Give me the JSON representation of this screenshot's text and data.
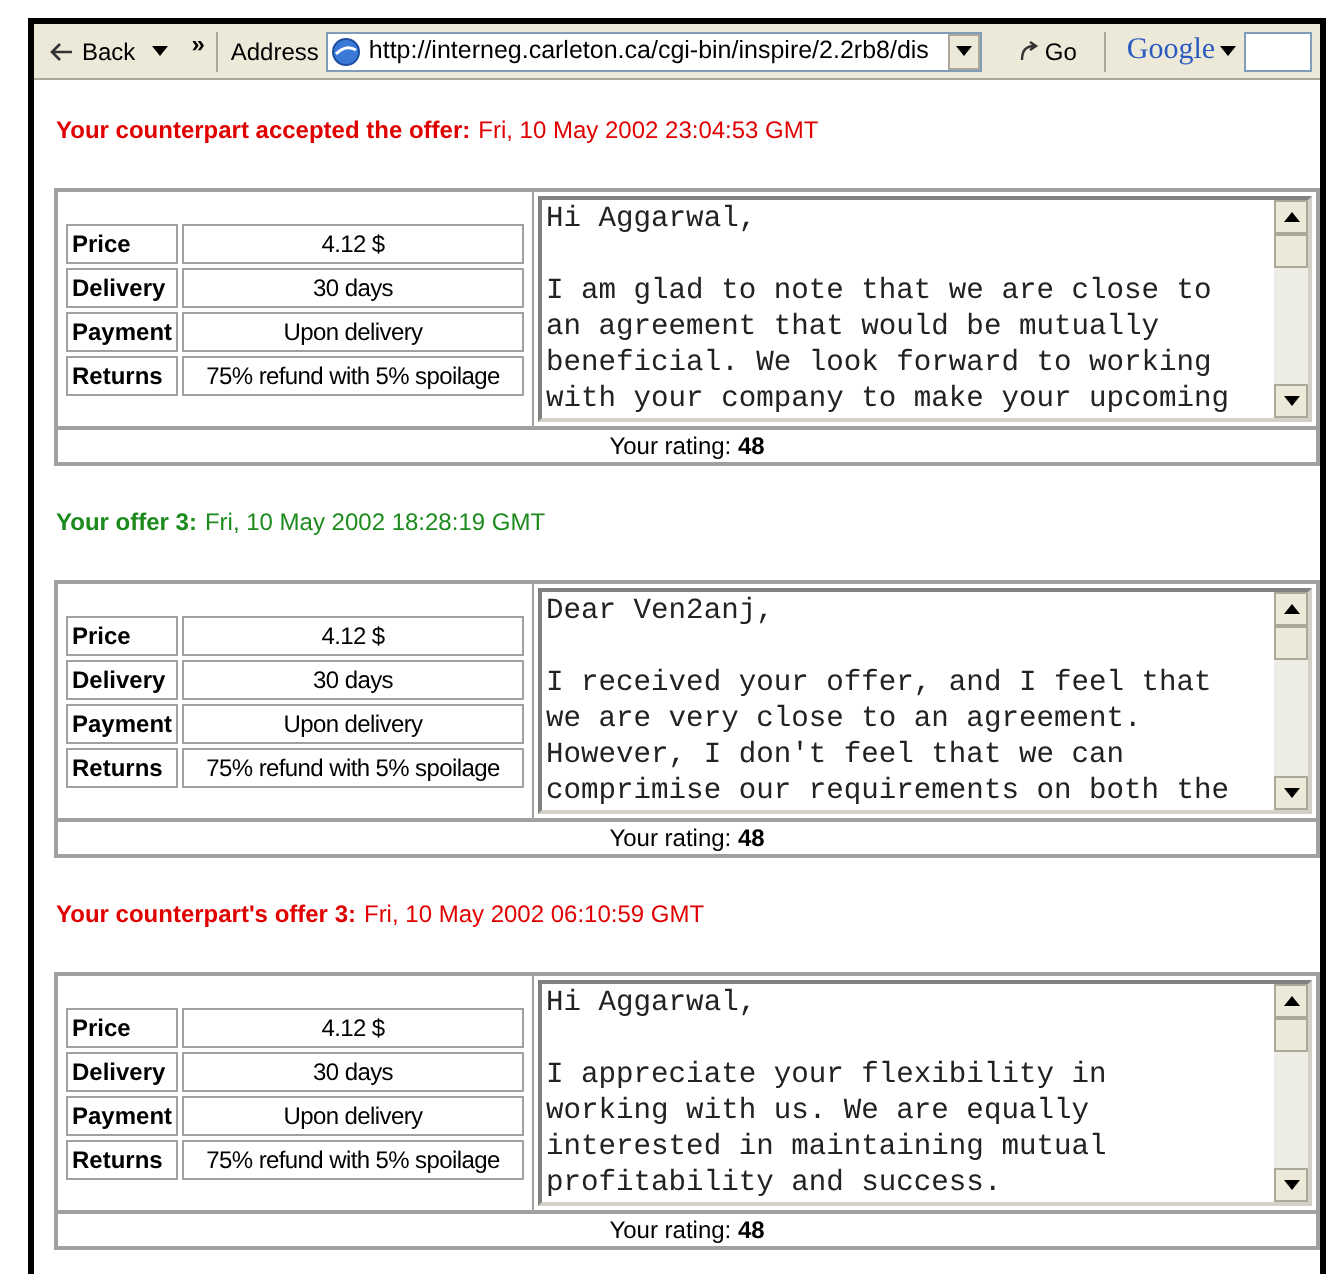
{
  "toolbar": {
    "back": "Back",
    "chevron": "»",
    "address_label": "Address",
    "url": "http://interneg.carleton.ca/cgi-bin/inspire/2.2rb8/dis",
    "go": "Go",
    "search_brand": "Google"
  },
  "offers": [
    {
      "kind": "counterpart",
      "label": "Your counterpart accepted the offer:",
      "date": "Fri, 10 May 2002 23:04:53 GMT",
      "terms": [
        {
          "name": "Price",
          "value": "4.12 $"
        },
        {
          "name": "Delivery",
          "value": "30 days"
        },
        {
          "name": "Payment",
          "value": "Upon delivery"
        },
        {
          "name": "Returns",
          "value": "75% refund with 5% spoilage"
        }
      ],
      "greeting": "Hi Aggarwal,",
      "message": [
        "I am glad to note that we are close to",
        "an agreement that would be mutually",
        "beneficial. We look forward to working",
        "with your company to make your upcoming"
      ],
      "rating_label": "Your rating:",
      "rating": "48"
    },
    {
      "kind": "own",
      "label": "Your offer 3:",
      "date": "Fri, 10 May 2002 18:28:19 GMT",
      "terms": [
        {
          "name": "Price",
          "value": "4.12 $"
        },
        {
          "name": "Delivery",
          "value": "30 days"
        },
        {
          "name": "Payment",
          "value": "Upon delivery"
        },
        {
          "name": "Returns",
          "value": "75% refund with 5% spoilage"
        }
      ],
      "greeting": "Dear Ven2anj,",
      "message": [
        "I received your offer, and I feel that",
        "we are very close to an agreement.",
        "However, I don't feel that we can",
        "comprimise our requirements on both the"
      ],
      "rating_label": "Your rating:",
      "rating": "48"
    },
    {
      "kind": "counterpart",
      "label": "Your counterpart's offer 3:",
      "date": "Fri, 10 May 2002 06:10:59 GMT",
      "terms": [
        {
          "name": "Price",
          "value": "4.12 $"
        },
        {
          "name": "Delivery",
          "value": "30 days"
        },
        {
          "name": "Payment",
          "value": "Upon delivery"
        },
        {
          "name": "Returns",
          "value": "75% refund with 5% spoilage"
        }
      ],
      "greeting": "Hi Aggarwal,",
      "message": [
        "I appreciate your flexibility in",
        "working with us. We are equally",
        "interested in maintaining mutual",
        "profitability and success."
      ],
      "rating_label": "Your rating:",
      "rating": "48"
    }
  ]
}
